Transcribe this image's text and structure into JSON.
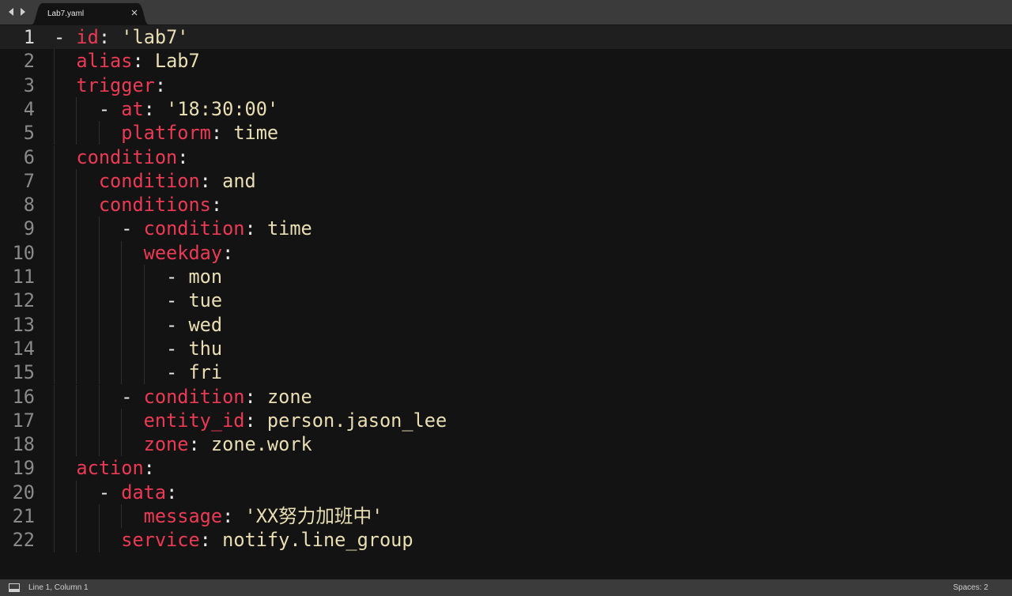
{
  "tab": {
    "title": "Lab7.yaml"
  },
  "icons": {
    "back": "arrow-left-icon",
    "forward": "arrow-right-icon",
    "close": "close-icon",
    "panel": "panel-toggle-icon"
  },
  "colors": {
    "key": "#ec3a55",
    "value": "#eadfb4",
    "punct": "#e8e8e8",
    "background": "#131313",
    "chrome": "#3b3b3b"
  },
  "editor": {
    "active_line": 1,
    "lines": [
      {
        "num": "1",
        "indent": "",
        "dash": true,
        "key": "id",
        "colon": ":",
        "value": "'lab7'"
      },
      {
        "num": "2",
        "indent": "  ",
        "dash": false,
        "key": "alias",
        "colon": ":",
        "value": "Lab7"
      },
      {
        "num": "3",
        "indent": "  ",
        "dash": false,
        "key": "trigger",
        "colon": ":",
        "value": ""
      },
      {
        "num": "4",
        "indent": "    ",
        "dash": true,
        "key": "at",
        "colon": ":",
        "value": "'18:30:00'"
      },
      {
        "num": "5",
        "indent": "      ",
        "dash": false,
        "key": "platform",
        "colon": ":",
        "value": "time"
      },
      {
        "num": "6",
        "indent": "  ",
        "dash": false,
        "key": "condition",
        "colon": ":",
        "value": ""
      },
      {
        "num": "7",
        "indent": "    ",
        "dash": false,
        "key": "condition",
        "colon": ":",
        "value": "and"
      },
      {
        "num": "8",
        "indent": "    ",
        "dash": false,
        "key": "conditions",
        "colon": ":",
        "value": ""
      },
      {
        "num": "9",
        "indent": "      ",
        "dash": true,
        "key": "condition",
        "colon": ":",
        "value": "time"
      },
      {
        "num": "10",
        "indent": "        ",
        "dash": false,
        "key": "weekday",
        "colon": ":",
        "value": ""
      },
      {
        "num": "11",
        "indent": "          ",
        "dash": true,
        "key": "",
        "colon": "",
        "value": "mon"
      },
      {
        "num": "12",
        "indent": "          ",
        "dash": true,
        "key": "",
        "colon": "",
        "value": "tue"
      },
      {
        "num": "13",
        "indent": "          ",
        "dash": true,
        "key": "",
        "colon": "",
        "value": "wed"
      },
      {
        "num": "14",
        "indent": "          ",
        "dash": true,
        "key": "",
        "colon": "",
        "value": "thu"
      },
      {
        "num": "15",
        "indent": "          ",
        "dash": true,
        "key": "",
        "colon": "",
        "value": "fri"
      },
      {
        "num": "16",
        "indent": "      ",
        "dash": true,
        "key": "condition",
        "colon": ":",
        "value": "zone"
      },
      {
        "num": "17",
        "indent": "        ",
        "dash": false,
        "key": "entity_id",
        "colon": ":",
        "value": "person.jason_lee"
      },
      {
        "num": "18",
        "indent": "        ",
        "dash": false,
        "key": "zone",
        "colon": ":",
        "value": "zone.work"
      },
      {
        "num": "19",
        "indent": "  ",
        "dash": false,
        "key": "action",
        "colon": ":",
        "value": ""
      },
      {
        "num": "20",
        "indent": "    ",
        "dash": true,
        "key": "data",
        "colon": ":",
        "value": ""
      },
      {
        "num": "21",
        "indent": "        ",
        "dash": false,
        "key": "message",
        "colon": ":",
        "value": "'XX努力加班中'"
      },
      {
        "num": "22",
        "indent": "      ",
        "dash": false,
        "key": "service",
        "colon": ":",
        "value": "notify.line_group"
      }
    ]
  },
  "status": {
    "cursor": "Line 1, Column 1",
    "indentation": "Spaces: 2"
  }
}
